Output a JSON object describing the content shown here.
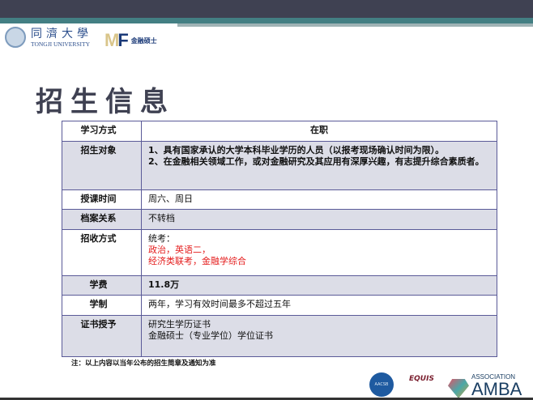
{
  "header": {
    "university_cn": "同濟大學",
    "university_en": "TONGJI UNIVERSITY",
    "mf_letters": "MF",
    "mf_text": "金融硕士"
  },
  "title": "招生信息",
  "table": {
    "header": {
      "key": "学习方式",
      "value": "在职"
    },
    "rows": [
      {
        "key": "招生对象",
        "lines": [
          "1、具有国家承认的大学本科毕业学历的人员（以报考现场确认时间为限）。",
          "2、在金融相关领域工作，或对金融研究及其应用有深厚兴趣，有志提升综合素质者。"
        ]
      },
      {
        "key": "授课时间",
        "value": "周六、周日"
      },
      {
        "key": "档案关系",
        "value": "不转档"
      },
      {
        "key": "招收方式",
        "lines": [
          "统考：",
          "政治，英语二，",
          "经济类联考，金融学综合"
        ]
      },
      {
        "key": "学费",
        "value": "11.8万"
      },
      {
        "key": "学制",
        "value": "两年，学习有效时间最多不超过五年"
      },
      {
        "key": "证书授予",
        "lines": [
          "研究生学历证书",
          "金融硕士（专业学位）学位证书"
        ]
      }
    ]
  },
  "note": "注：以上内容以当年公布的招生简章及通知为准",
  "accreditations": {
    "aacsb": "AACSB",
    "equis": "EQUIS",
    "amba_top": "ASSOCIATION",
    "amba": "AMBA"
  },
  "colors": {
    "topbar": "#3f4152",
    "teal": "#437f83",
    "row_shade": "#dcdde7",
    "red": "#e41b1b"
  }
}
